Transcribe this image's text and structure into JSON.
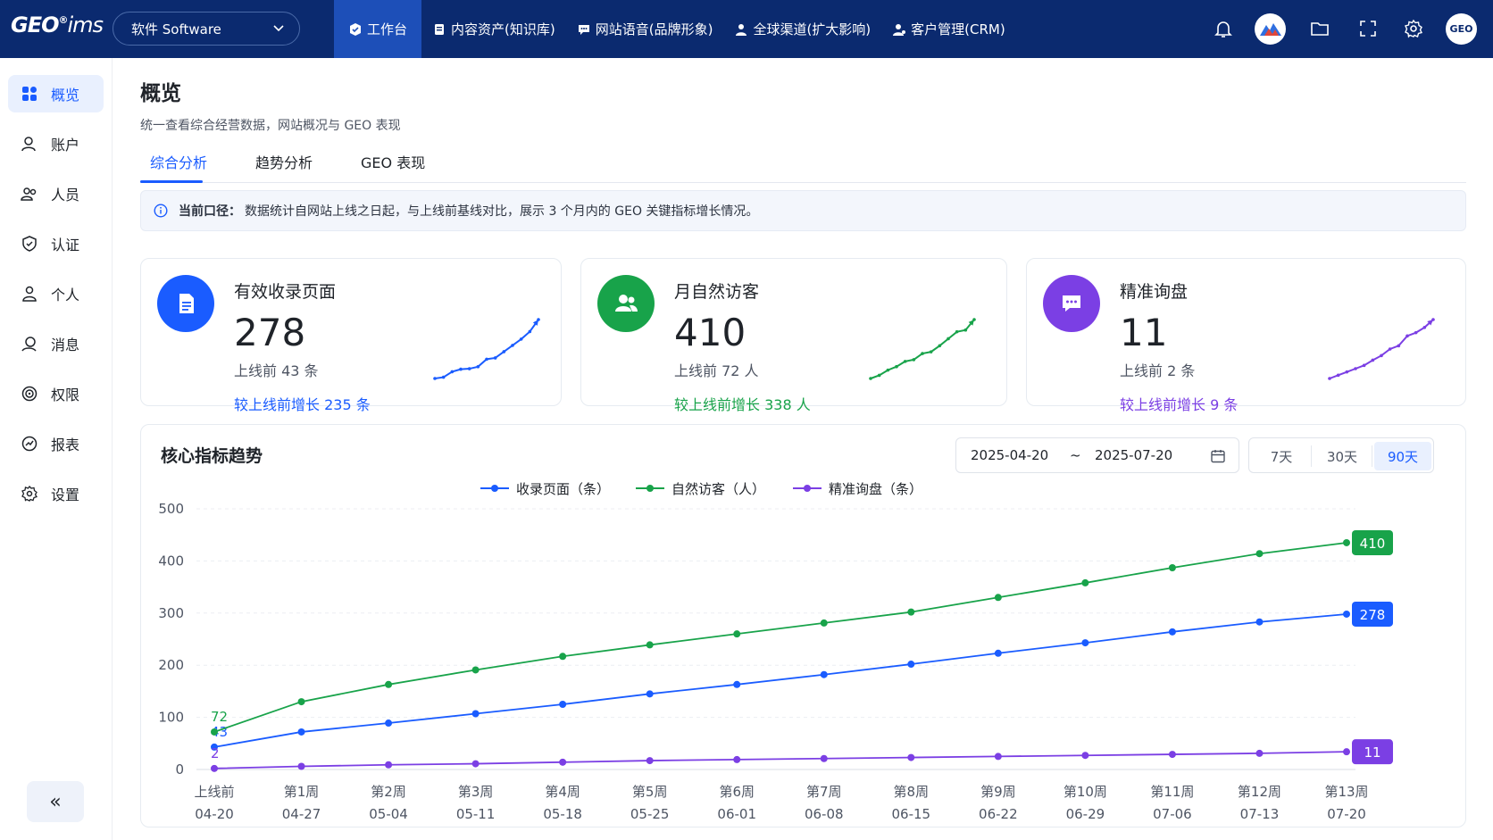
{
  "logo": {
    "main": "GEO",
    "sup": "®",
    "tail": "ims"
  },
  "product_select": {
    "label": "软件 Software"
  },
  "nav": [
    {
      "label": "工作台",
      "icon": "cube-icon",
      "active": true
    },
    {
      "label": "内容资产(知识库)",
      "icon": "document-icon",
      "active": false
    },
    {
      "label": "网站语音(品牌形象)",
      "icon": "chat-icon",
      "active": false
    },
    {
      "label": "全球渠道(扩大影响)",
      "icon": "globe-users-icon",
      "active": false
    },
    {
      "label": "客户管理(CRM)",
      "icon": "user-icon",
      "active": false
    }
  ],
  "user": {
    "avatar_text": "GEO"
  },
  "sidebar": {
    "items": [
      {
        "label": "概览",
        "icon": "grid-icon",
        "active": true
      },
      {
        "label": "账户",
        "icon": "account-icon",
        "active": false
      },
      {
        "label": "人员",
        "icon": "people-icon",
        "active": false
      },
      {
        "label": "认证",
        "icon": "shield-icon",
        "active": false
      },
      {
        "label": "个人",
        "icon": "person-icon",
        "active": false
      },
      {
        "label": "消息",
        "icon": "message-icon",
        "active": false
      },
      {
        "label": "权限",
        "icon": "permission-icon",
        "active": false
      },
      {
        "label": "报表",
        "icon": "report-icon",
        "active": false
      },
      {
        "label": "设置",
        "icon": "gear-icon",
        "active": false
      }
    ],
    "collapse_label": "«"
  },
  "page": {
    "title": "概览",
    "subtitle": "统一查看综合经营数据，网站概况与 GEO 表现",
    "tabs": [
      "综合分析",
      "趋势分析",
      "GEO 表现"
    ],
    "active_tab": 0
  },
  "info": {
    "label": "当前口径：",
    "text": "数据统计自网站上线之日起，与上线前基线对比，展示 3 个月内的 GEO 关键指标增长情况。"
  },
  "cards": [
    {
      "title": "有效收录页面",
      "value": "278",
      "before": "上线前 43 条",
      "growth": "较上线前增长 235 条",
      "color": "#1a5cff",
      "icon": "document-icon",
      "spark": [
        43,
        48,
        70,
        80,
        82,
        90,
        120,
        125,
        150,
        175,
        200,
        230,
        278
      ]
    },
    {
      "title": "月自然访客",
      "value": "410",
      "before": "上线前 72 人",
      "growth": "较上线前增长 338 人",
      "color": "#18a34a",
      "icon": "users-icon",
      "spark": [
        72,
        90,
        120,
        140,
        170,
        180,
        215,
        225,
        260,
        300,
        340,
        350,
        410
      ]
    },
    {
      "title": "精准询盘",
      "value": "11",
      "before": "上线前 2 条",
      "growth": "较上线前增长 9 条",
      "color": "#7b3fe4",
      "icon": "message-icon",
      "spark": [
        2,
        2.5,
        3,
        3.5,
        4,
        4.8,
        5.5,
        6.5,
        7,
        8.5,
        9,
        9.8,
        11
      ]
    }
  ],
  "trend": {
    "title": "核心指标趋势",
    "date_start": "2025-04-20",
    "date_sep": "~",
    "date_end": "2025-07-20",
    "ranges": [
      "7天",
      "30天",
      "90天"
    ],
    "active_range": 2
  },
  "chart_data": {
    "type": "line",
    "x": [
      "上线前",
      "第1周",
      "第2周",
      "第3周",
      "第4周",
      "第5周",
      "第6周",
      "第7周",
      "第8周",
      "第9周",
      "第10周",
      "第11周",
      "第12周",
      "第13周"
    ],
    "x_dates": [
      "04-20",
      "04-27",
      "05-04",
      "05-11",
      "05-18",
      "05-25",
      "06-01",
      "06-08",
      "06-15",
      "06-22",
      "06-29",
      "07-06",
      "07-13",
      "07-20"
    ],
    "ylim": [
      0,
      500
    ],
    "yticks": [
      0,
      100,
      200,
      300,
      400,
      500
    ],
    "grid": true,
    "legend_position": "top-center",
    "series": [
      {
        "name": "收录页面（条）",
        "color": "#1a5cff",
        "values": [
          43,
          72,
          89,
          107,
          125,
          145,
          163,
          182,
          202,
          223,
          243,
          264,
          283,
          298
        ],
        "start_label": "43",
        "end_label": "278"
      },
      {
        "name": "自然访客（人）",
        "color": "#18a34a",
        "values": [
          72,
          130,
          163,
          191,
          217,
          239,
          260,
          281,
          302,
          330,
          358,
          387,
          414,
          435
        ],
        "start_label": "72",
        "end_label": "410"
      },
      {
        "name": "精准询盘（条）",
        "color": "#7b3fe4",
        "values": [
          2,
          6,
          9,
          11,
          14,
          17,
          19,
          21,
          23,
          25,
          27,
          29,
          31,
          34
        ],
        "start_label": "2",
        "end_label": "11"
      }
    ]
  }
}
